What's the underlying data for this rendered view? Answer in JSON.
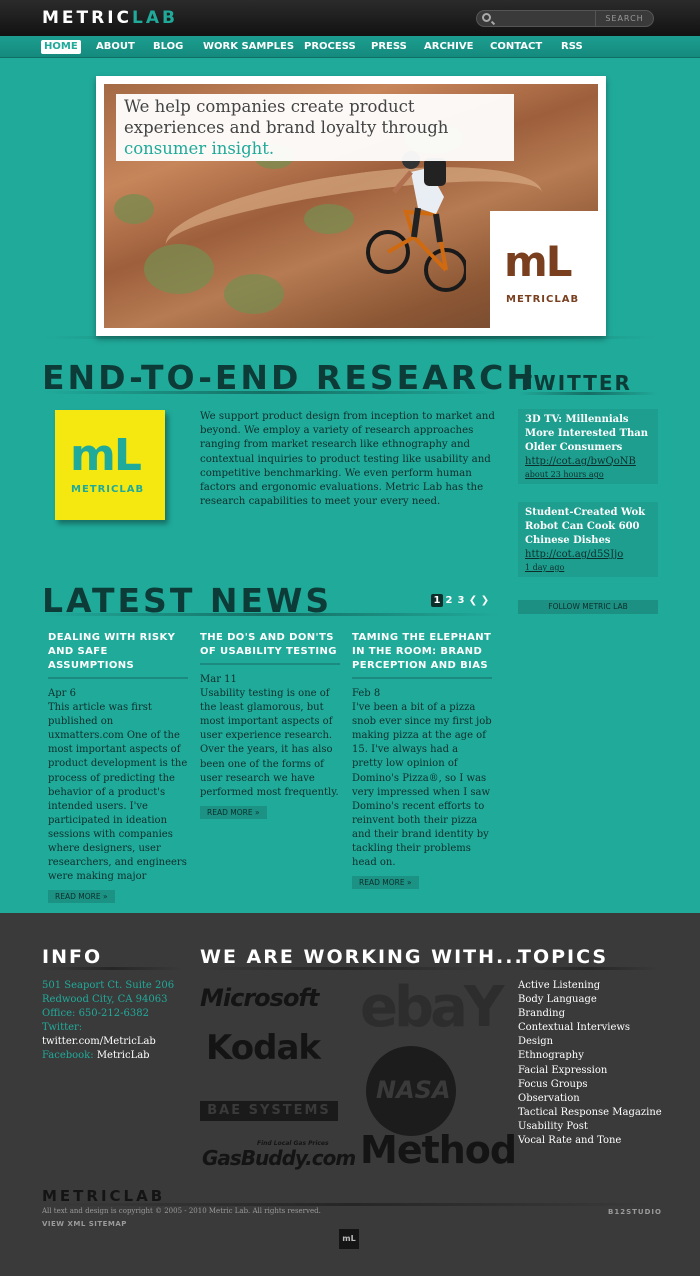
{
  "header": {
    "logo_metric": "METRIC",
    "logo_lab": "LAB",
    "search_placeholder": "",
    "search_button": "SEARCH"
  },
  "nav": {
    "items": [
      "HOME",
      "ABOUT",
      "BLOG",
      "WORK SAMPLES",
      "PROCESS",
      "PRESS",
      "ARCHIVE",
      "CONTACT",
      "RSS"
    ],
    "active": "HOME"
  },
  "hero": {
    "headline_part1": "We help companies create product experiences and brand loyalty through ",
    "headline_accent": "consumer insight.",
    "logo_letters": "mL",
    "logo_word": "METRICLAB"
  },
  "research": {
    "title": "END-TO-END RESEARCH",
    "logo_letters": "mL",
    "logo_word": "METRICLAB",
    "text": "We support product design from inception to market and beyond. We employ a variety of research approaches ranging from market research like ethnography and contextual inquiries to product testing like usability and competitive benchmarking. We even perform human factors and ergonomic evaluations. Metric Lab has the research capabilities to meet your every need."
  },
  "news": {
    "title": "LATEST NEWS",
    "pages": [
      "1",
      "2",
      "3"
    ],
    "current_page": "1",
    "prev_icon": "chevron-left-icon",
    "next_icon": "chevron-right-icon",
    "articles": [
      {
        "title": "DEALING WITH RISKY AND SAFE ASSUMPTIONS",
        "date": "Apr 6",
        "body": "This article was first published on uxmatters.com One of the most important aspects of product development is the process of predicting the behavior of a product's intended users. I've participated in ideation sessions with companies where designers, user researchers, and engineers were making major",
        "more": "READ MORE »"
      },
      {
        "title": "THE DO'S AND DON'TS OF USABILITY TESTING",
        "date": "Mar 11",
        "body": "Usability testing is one of the least glamorous, but most important aspects of user experience research. Over the years, it has also been one of the forms of user research we have performed most frequently.",
        "more": "READ MORE »"
      },
      {
        "title": "TAMING THE ELEPHANT IN THE ROOM: BRAND PERCEPTION AND BIAS",
        "date": "Feb 8",
        "body": "I've been a bit of a pizza snob ever since my first job making pizza at the age of 15. I've always had a pretty low opinion of Domino's Pizza®, so I was very impressed when I saw Domino's recent efforts to reinvent both their pizza and their brand identity by tackling their problems head on.",
        "more": "READ MORE »"
      }
    ]
  },
  "twitter": {
    "title": "TWITTER",
    "tweets": [
      {
        "text": "3D TV: Millennials More Interested Than Older Consumers",
        "link": "http://cot.ag/bwQoNB",
        "ago": "about 23 hours ago"
      },
      {
        "text": "Student-Created Wok Robot Can Cook 600 Chinese Dishes",
        "link": "http://cot.ag/d5SJjo",
        "ago": "1 day ago"
      }
    ],
    "follow": "FOLLOW METRIC LAB"
  },
  "footer": {
    "info_title": "INFO",
    "address1": "501 Seaport Ct. Suite 206",
    "address2": "Redwood City, CA 94063",
    "office": "Office: 650-212-6382",
    "twitter_label": "Twitter:",
    "twitter_value": "twitter.com/MetricLab",
    "facebook_label": "Facebook:",
    "facebook_value": "MetricLab",
    "clients_title": "WE ARE WORKING WITH...",
    "clients": [
      "Microsoft",
      "Kodak",
      "BAE SYSTEMS",
      "GasBuddy.com",
      "Find Local Gas Prices",
      "ebaY",
      "NASA",
      "Method"
    ],
    "topics_title": "TOPICS",
    "topics": [
      "Active Listening",
      "Body Language",
      "Branding",
      "Contextual Interviews",
      "Design",
      "Ethnography",
      "Facial Expression",
      "Focus Groups",
      "Observation",
      "Tactical Response Magazine",
      "Usability Post",
      "Vocal Rate and Tone"
    ],
    "bottom_logo": "METRICLAB",
    "copyright": "All text and design is copyright © 2005 - 2010 Metric Lab. All rights reserved.",
    "xml": "VIEW XML SITEMAP",
    "credit": "B12STUDIO",
    "mini_logo": "mL"
  }
}
